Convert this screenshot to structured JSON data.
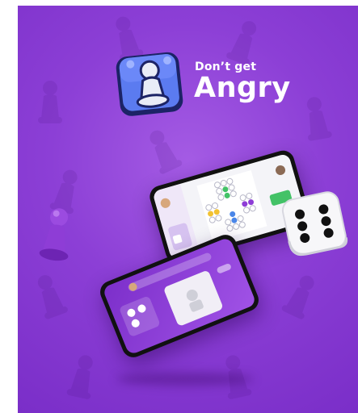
{
  "brand": {
    "title_small": "Don’t get",
    "title_big": "Angry"
  },
  "colors": {
    "background": "#8c3fd6",
    "logo_blue": "#5b7bf0",
    "pawn_purple": "#8e3dd6",
    "accent_green": "#43c267",
    "accent_yellow": "#f2c232"
  },
  "icons": {
    "logo": "pawn-logo-icon",
    "dice": "dice-icon",
    "pawn": "pawn-icon"
  }
}
